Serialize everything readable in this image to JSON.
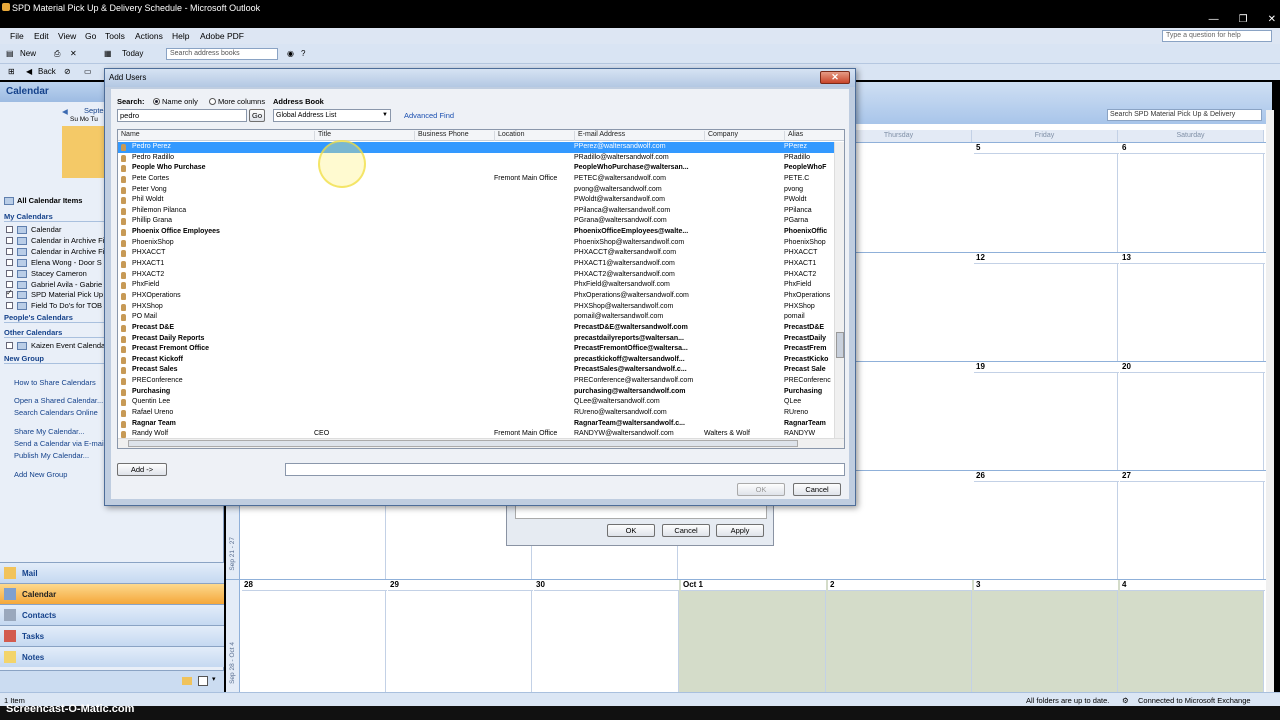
{
  "window": {
    "title": "SPD Material Pick Up & Delivery Schedule - Microsoft Outlook",
    "controls": [
      "—",
      "❐",
      "✕"
    ]
  },
  "menu": [
    "File",
    "Edit",
    "View",
    "Go",
    "Tools",
    "Actions",
    "Help",
    "Adobe PDF"
  ],
  "help_placeholder": "Type a question for help",
  "toolbar": {
    "new_label": "New",
    "today_label": "Today",
    "search_placeholder": "Search address books",
    "back_label": "Back"
  },
  "nav": {
    "header": "Calendar",
    "mini_month": "Septe",
    "mini_days": "Su Mo Tu",
    "all_calendar_items": "All Calendar Items",
    "my_calendars_header": "My Calendars",
    "my_calendars": [
      {
        "label": "Calendar",
        "checked": false
      },
      {
        "label": "Calendar in Archive Fi",
        "checked": false
      },
      {
        "label": "Calendar in Archive Fi",
        "checked": false
      },
      {
        "label": "Elena Wong - Door S",
        "checked": false
      },
      {
        "label": "Stacey Cameron",
        "checked": false
      },
      {
        "label": "Gabriel Avila - Gabrie",
        "checked": false
      },
      {
        "label": "SPD Material Pick Up",
        "checked": true
      },
      {
        "label": "Field To Do's for TOB",
        "checked": false
      }
    ],
    "peoples_calendars_header": "People's Calendars",
    "other_calendars_header": "Other Calendars",
    "other_calendars": [
      {
        "label": "Kaizen Event Calenda",
        "checked": false
      }
    ],
    "new_group": "New Group",
    "links": [
      "How to Share Calendars",
      "Open a Shared Calendar...",
      "Search Calendars Online",
      "Share My Calendar...",
      "Send a Calendar via E-mail...",
      "Publish My Calendar...",
      "Add New Group"
    ],
    "buttons": [
      {
        "label": "Mail",
        "active": false
      },
      {
        "label": "Calendar",
        "active": true
      },
      {
        "label": "Contacts",
        "active": false
      },
      {
        "label": "Tasks",
        "active": false
      },
      {
        "label": "Notes",
        "active": false
      }
    ]
  },
  "calendar": {
    "search_placeholder": "Search SPD Material Pick Up & Delivery",
    "day_headers": [
      "Thursday",
      "Friday",
      "Saturday"
    ],
    "weeks": [
      {
        "label": "",
        "days": [
          "",
          "",
          "",
          "",
          "",
          "5",
          "6"
        ]
      },
      {
        "label": "",
        "days": [
          "",
          "",
          "",
          "",
          "",
          "12",
          "13"
        ]
      },
      {
        "label": "",
        "days": [
          "",
          "",
          "",
          "",
          "",
          "19",
          "20"
        ]
      },
      {
        "label": "Sep 21 - 27",
        "days": [
          "",
          "",
          "",
          "",
          "",
          "26",
          "27"
        ]
      },
      {
        "label": "Sep 28 - Oct 4",
        "days": [
          "28",
          "29",
          "30",
          "Oct 1",
          "2",
          "3",
          "4"
        ]
      }
    ]
  },
  "dialog": {
    "title": "Add Users",
    "search_label": "Search:",
    "name_only": "Name only",
    "more_columns": "More columns",
    "address_book_label": "Address Book",
    "search_value": "pedro",
    "go_label": "Go",
    "address_book_value": "Global Address List",
    "advanced_find": "Advanced Find",
    "columns": [
      "Name",
      "Title",
      "Business Phone",
      "Location",
      "E-mail Address",
      "Company",
      "Alias"
    ],
    "rows": [
      {
        "name": "Pedro Perez",
        "title": "",
        "location": "",
        "email": "PPerez@waltersandwolf.com",
        "company": "",
        "alias": "PPerez",
        "bold": false,
        "selected": true
      },
      {
        "name": "Pedro Radillo",
        "title": "",
        "location": "",
        "email": "PRadillo@waltersandwolf.com",
        "company": "",
        "alias": "PRadillo",
        "bold": false,
        "selected": false
      },
      {
        "name": "People Who Purchase",
        "title": "",
        "location": "",
        "email": "PeopleWhoPurchase@waltersan...",
        "company": "",
        "alias": "PeopleWhoF",
        "bold": true,
        "selected": false
      },
      {
        "name": "Pete Cortes",
        "title": "",
        "location": "Fremont Main Office",
        "email": "PETEC@waltersandwolf.com",
        "company": "",
        "alias": "PETE.C",
        "bold": false,
        "selected": false
      },
      {
        "name": "Peter Vong",
        "title": "",
        "location": "",
        "email": "pvong@waltersandwolf.com",
        "company": "",
        "alias": "pvong",
        "bold": false,
        "selected": false
      },
      {
        "name": "Phil Woldt",
        "title": "",
        "location": "",
        "email": "PWoldt@waltersandwolf.com",
        "company": "",
        "alias": "PWoldt",
        "bold": false,
        "selected": false
      },
      {
        "name": "Philemon Pilanca",
        "title": "",
        "location": "",
        "email": "PPilanca@waltersandwolf.com",
        "company": "",
        "alias": "PPilanca",
        "bold": false,
        "selected": false
      },
      {
        "name": "Phillip Grana",
        "title": "",
        "location": "",
        "email": "PGrana@waltersandwolf.com",
        "company": "",
        "alias": "PGarna",
        "bold": false,
        "selected": false
      },
      {
        "name": "Phoenix Office Employees",
        "title": "",
        "location": "",
        "email": "PhoenixOfficeEmployees@walte...",
        "company": "",
        "alias": "PhoenixOffic",
        "bold": true,
        "selected": false
      },
      {
        "name": "PhoenixShop",
        "title": "",
        "location": "",
        "email": "PhoenixShop@waltersandwolf.com",
        "company": "",
        "alias": "PhoenixShop",
        "bold": false,
        "selected": false
      },
      {
        "name": "PHXACCT",
        "title": "",
        "location": "",
        "email": "PHXACCT@waltersandwolf.com",
        "company": "",
        "alias": "PHXACCT",
        "bold": false,
        "selected": false
      },
      {
        "name": "PHXACT1",
        "title": "",
        "location": "",
        "email": "PHXACT1@waltersandwolf.com",
        "company": "",
        "alias": "PHXACT1",
        "bold": false,
        "selected": false
      },
      {
        "name": "PHXACT2",
        "title": "",
        "location": "",
        "email": "PHXACT2@waltersandwolf.com",
        "company": "",
        "alias": "PHXACT2",
        "bold": false,
        "selected": false
      },
      {
        "name": "PhxField",
        "title": "",
        "location": "",
        "email": "PhxField@waltersandwolf.com",
        "company": "",
        "alias": "PhxField",
        "bold": false,
        "selected": false
      },
      {
        "name": "PHXOperations",
        "title": "",
        "location": "",
        "email": "PhxOperations@waltersandwolf.com",
        "company": "",
        "alias": "PhxOperations",
        "bold": false,
        "selected": false
      },
      {
        "name": "PHXShop",
        "title": "",
        "location": "",
        "email": "PHXShop@waltersandwolf.com",
        "company": "",
        "alias": "PHXShop",
        "bold": false,
        "selected": false
      },
      {
        "name": "PO Mail",
        "title": "",
        "location": "",
        "email": "pomail@waltersandwolf.com",
        "company": "",
        "alias": "pomail",
        "bold": false,
        "selected": false
      },
      {
        "name": "Precast D&E",
        "title": "",
        "location": "",
        "email": "PrecastD&E@waltersandwolf.com",
        "company": "",
        "alias": "PrecastD&E",
        "bold": true,
        "selected": false
      },
      {
        "name": "Precast Daily Reports",
        "title": "",
        "location": "",
        "email": "precastdailyreports@waltersan...",
        "company": "",
        "alias": "PrecastDaily",
        "bold": true,
        "selected": false
      },
      {
        "name": "Precast Fremont Office",
        "title": "",
        "location": "",
        "email": "PrecastFremontOffice@waltersa...",
        "company": "",
        "alias": "PrecastFrem",
        "bold": true,
        "selected": false
      },
      {
        "name": "Precast Kickoff",
        "title": "",
        "location": "",
        "email": "precastkickoff@waltersandwolf...",
        "company": "",
        "alias": "PrecastKicko",
        "bold": true,
        "selected": false
      },
      {
        "name": "Precast Sales",
        "title": "",
        "location": "",
        "email": "PrecastSales@waltersandwolf.c...",
        "company": "",
        "alias": "Precast Sale",
        "bold": true,
        "selected": false
      },
      {
        "name": "PREConference",
        "title": "",
        "location": "",
        "email": "PREConference@waltersandwolf.com",
        "company": "",
        "alias": "PREConferenc",
        "bold": false,
        "selected": false
      },
      {
        "name": "Purchasing",
        "title": "",
        "location": "",
        "email": "purchasing@waltersandwolf.com",
        "company": "",
        "alias": "Purchasing",
        "bold": true,
        "selected": false
      },
      {
        "name": "Quentin Lee",
        "title": "",
        "location": "",
        "email": "QLee@waltersandwolf.com",
        "company": "",
        "alias": "QLee",
        "bold": false,
        "selected": false
      },
      {
        "name": "Rafael Ureno",
        "title": "",
        "location": "",
        "email": "RUreno@waltersandwolf.com",
        "company": "",
        "alias": "RUreno",
        "bold": false,
        "selected": false
      },
      {
        "name": "Ragnar Team",
        "title": "",
        "location": "",
        "email": "RagnarTeam@waltersandwolf.c...",
        "company": "",
        "alias": "RagnarTeam",
        "bold": true,
        "selected": false
      },
      {
        "name": "Randy Wolf",
        "title": "CEO",
        "location": "Fremont Main Office",
        "email": "RANDYW@waltersandwolf.com",
        "company": "Walters & Wolf",
        "alias": "RANDYW",
        "bold": false,
        "selected": false
      }
    ],
    "add_button": "Add ->",
    "ok_label": "OK",
    "cancel_label": "Cancel"
  },
  "behind_dialog": {
    "ok": "OK",
    "cancel": "Cancel",
    "apply": "Apply"
  },
  "status": {
    "items": "1 Item",
    "folders": "All folders are up to date.",
    "connection": "Connected to Microsoft Exchange"
  },
  "watermark": "Screencast-O-Matic.com"
}
